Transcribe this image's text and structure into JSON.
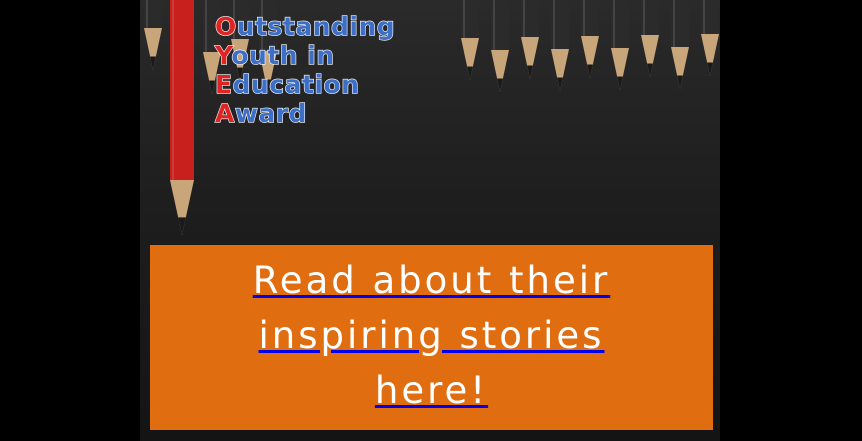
{
  "award": {
    "lines": [
      {
        "first": "O",
        "rest": "utstanding"
      },
      {
        "first": "Y",
        "rest": "outh in"
      },
      {
        "first": "E",
        "rest": "ducation"
      },
      {
        "first": "A",
        "rest": "ward"
      }
    ],
    "colors": {
      "initial": "#e02424",
      "text": "#3d6fc6",
      "outline": "#ffffff"
    }
  },
  "cta": {
    "lines": [
      "Read about their",
      "inspiring stories",
      "here!"
    ],
    "background": "#e06d10",
    "text_color": "#ffffff"
  },
  "decor": {
    "pencil_icon": "pencil-icon",
    "accent_pencil_color": "#c8201c",
    "pencil_color": "#2b2b2b"
  }
}
